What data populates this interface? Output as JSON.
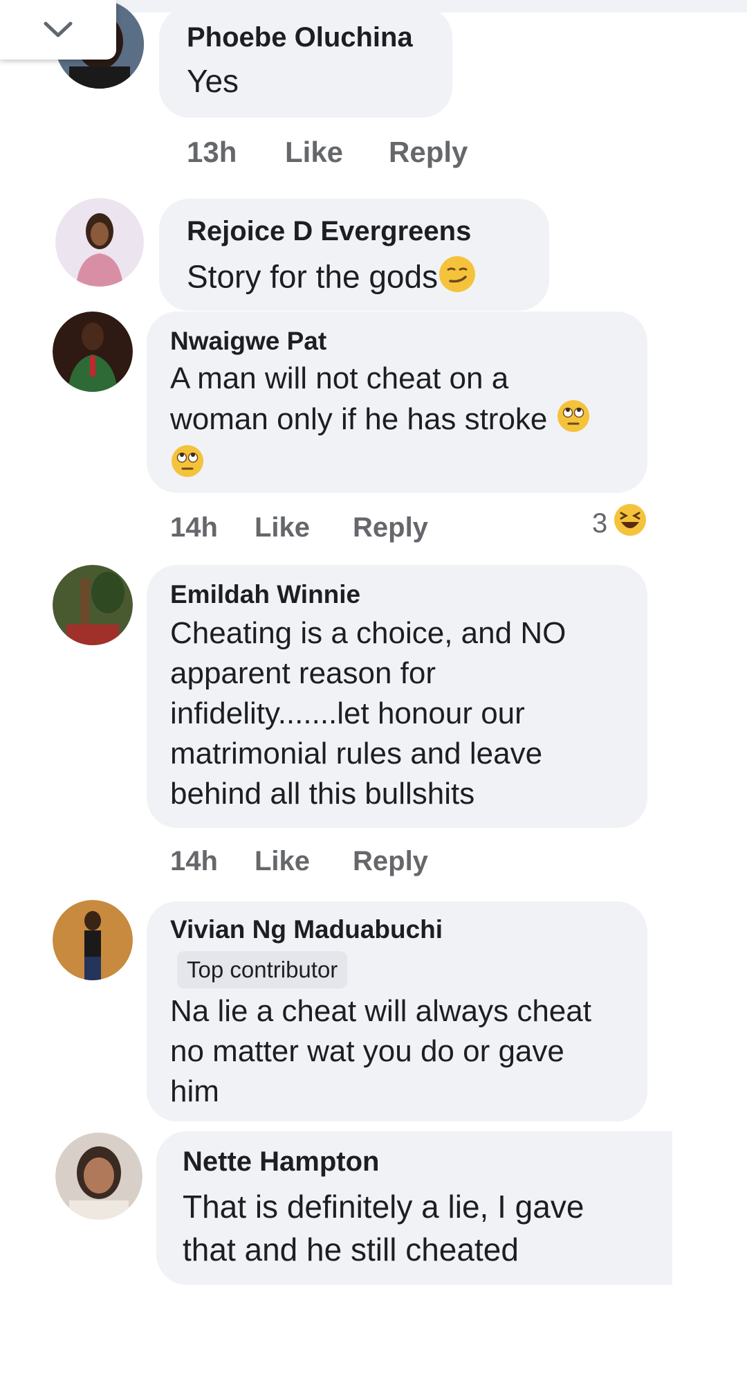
{
  "header": {
    "collapse_icon": "chevron-down-icon"
  },
  "comments": [
    {
      "author": "Phoebe Oluchina",
      "text": "Yes",
      "time": "13h",
      "like": "Like",
      "reply": "Reply"
    },
    {
      "author": "Rejoice D Evergreens",
      "text": "Story for the gods",
      "emoji": "smirking-face"
    },
    {
      "author": "Nwaigwe Pat",
      "text_lines": [
        "A man will not cheat on a",
        "woman only if he has stroke"
      ],
      "time": "14h",
      "like": "Like",
      "reply": "Reply",
      "reaction_count": "3",
      "reaction_icon": "laughing-face-icon",
      "emoji": "face-with-rolling-eyes"
    },
    {
      "author": "Emildah Winnie",
      "text_lines": [
        "Cheating is a choice, and NO",
        "apparent reason for",
        "infidelity.......let honour our",
        "matrimonial rules and leave",
        "behind all this bullshits"
      ],
      "time": "14h",
      "like": "Like",
      "reply": "Reply"
    },
    {
      "author": "Vivian Ng Maduabuchi",
      "badge": "Top contributor",
      "text_lines": [
        "Na lie a cheat will always cheat",
        "no matter wat you do or gave",
        "him"
      ]
    },
    {
      "author": "Nette Hampton",
      "text_lines": [
        "That is definitely a lie, I gave",
        "that and he still cheated"
      ]
    }
  ]
}
